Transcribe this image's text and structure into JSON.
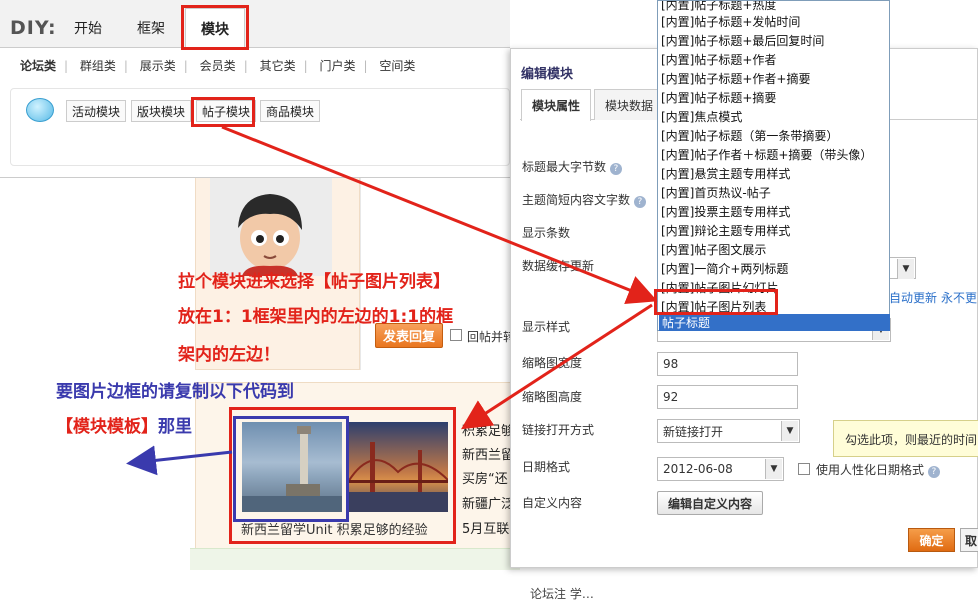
{
  "diy": {
    "logo": "DIY:",
    "tabs": [
      "开始",
      "框架",
      "模块"
    ],
    "categories": [
      "论坛类",
      "群组类",
      "展示类",
      "会员类",
      "其它类",
      "门户类",
      "空间类"
    ],
    "sub_buttons": [
      "活动模块",
      "版块模块",
      "帖子模块",
      "商品模块"
    ]
  },
  "page": {
    "reply_button": "发表回复",
    "reply_checkbox_label": "回帖并转",
    "caption": "新西兰留学Unit   积累足够的经验",
    "news_items": [
      "积累足够",
      "新西兰留",
      "买房“还",
      "新疆广泛",
      "5月互联"
    ],
    "bottom_text": "论坛注 学…"
  },
  "dialog": {
    "title": "编辑模块",
    "tabs": [
      "模块属性",
      "模块数据"
    ],
    "labels": {
      "title_max": "标题最大字节数",
      "summary_len": "主题简短内容文字数",
      "show_count": "显示条数",
      "cache_update": "数据缓存更新",
      "display_style": "显示样式",
      "thumb_width": "缩略图宽度",
      "thumb_height": "缩略图高度",
      "link_open": "链接打开方式",
      "date_format": "日期格式",
      "custom_content": "自定义内容"
    },
    "values": {
      "thumb_width": "98",
      "thumb_height": "92",
      "link_open": "新链接打开",
      "date_format": "2012-06-08"
    },
    "humanize_date_label": "使用人性化日期格式",
    "auto_update": "自动更新",
    "never_update": "永不更",
    "edit_custom_button": "编辑自定义内容",
    "ok_button": "确定",
    "cancel_button": "取",
    "tooltip": "勾选此项，则最近的时间"
  },
  "dropdown": {
    "items": [
      "[内置]帖子标题+热度",
      "[内置]帖子标题+发帖时间",
      "[内置]帖子标题+最后回复时间",
      "[内置]帖子标题+作者",
      "[内置]帖子标题+作者+摘要",
      "[内置]帖子标题+摘要",
      "[内置]焦点模式",
      "[内置]帖子标题（第一条带摘要）",
      "[内置]帖子作者＋标题+摘要（带头像）",
      "[内置]悬赏主题专用样式",
      "[内置]首页热议-帖子",
      "[内置]投票主题专用样式",
      "[内置]辩论主题专用样式",
      "[内置]帖子图文展示",
      "[内置]一简介+两列标题",
      "[内置]帖子图片幻灯片",
      "[内置]帖子图片列表"
    ],
    "selected": "帖子标题"
  },
  "annotations": {
    "red_line1": "拉个模块进来选择【帖子图片列表】",
    "red_line2": "放在1：1框架里内的左边的1:1的框",
    "red_line3": "架内的左边！",
    "blue_line1": "要图片边框的请复制以下代码到",
    "blue_line2_bracket": "【模块模板】",
    "blue_line2_rest": "那里"
  },
  "colors": {
    "annotation_red": "#e2231a",
    "annotation_blue": "#3a3aad",
    "accent_orange": "#e9761f",
    "selection_blue": "#3370c8"
  }
}
